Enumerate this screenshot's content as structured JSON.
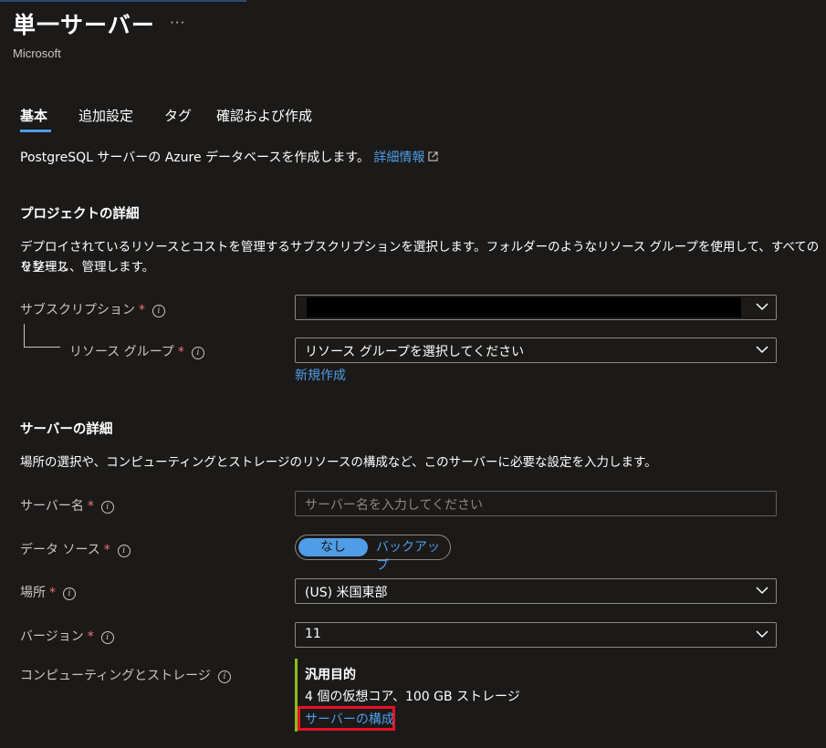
{
  "header": {
    "title": "単一サーバー",
    "more_label": "···",
    "publisher": "Microsoft"
  },
  "tabs": [
    {
      "label": "基本",
      "active": true
    },
    {
      "label": "追加設定",
      "active": false
    },
    {
      "label": "タグ",
      "active": false
    },
    {
      "label": "確認および作成",
      "active": false
    }
  ],
  "intro": {
    "text": "PostgreSQL サーバーの Azure データベースを作成します。",
    "link": "詳細情報"
  },
  "project": {
    "heading": "プロジェクトの詳細",
    "description_line1": "デプロイされているリソースとコストを管理するサブスクリプションを選択します。フォルダーのようなリソース グループを使用して、すべてのリソース",
    "description_line2": "を整理し、管理します。",
    "subscription_label": "サブスクリプション",
    "subscription_value": "",
    "resource_group_label": "リソース グループ",
    "resource_group_value": "リソース グループを選択してください",
    "create_new": "新規作成"
  },
  "server": {
    "heading": "サーバーの詳細",
    "description": "場所の選択や、コンピューティングとストレージのリソースの構成など、このサーバーに必要な設定を入力します。",
    "name_label": "サーバー名",
    "name_placeholder": "サーバー名を入力してください",
    "data_source_label": "データ ソース",
    "data_source_options": [
      "なし",
      "バックアップ"
    ],
    "location_label": "場所",
    "location_value": "(US) 米国東部",
    "version_label": "バージョン",
    "version_value": "11",
    "compute_label": "コンピューティングとストレージ",
    "compute_tier": "汎用目的",
    "compute_detail": "4 個の仮想コア、100 GB ストレージ",
    "configure_link": "サーバーの構成"
  },
  "required_mark": "*",
  "info_glyph": "i",
  "colors": {
    "background": "#1b1a19",
    "accent": "#4f9de6",
    "required": "#f1707b",
    "highlight": "#e81123",
    "compute_bar": "#8cbd18"
  }
}
